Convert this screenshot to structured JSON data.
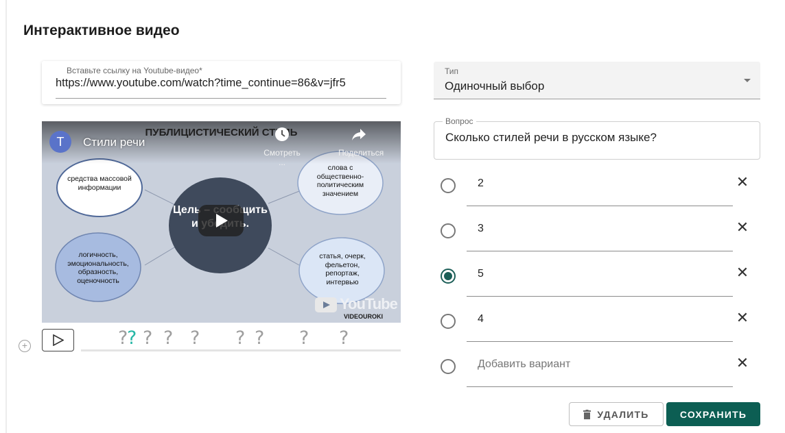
{
  "page": {
    "title": "Интерактивное видео"
  },
  "url_field": {
    "label": "Вставьте ссылку на Youtube-видео*",
    "value": "https://www.youtube.com/watch?time_continue=86&v=jfr5"
  },
  "video": {
    "slide_title": "ПУБЛИЦИСТИЧЕСКИЙ СТИЛЬ",
    "channel_initial": "Т",
    "channel_name": "Стили речи",
    "watch_later_label": "Смотреть ...",
    "share_label": "Поделиться",
    "bubbles": [
      "средства массовой информации",
      "слова с общественно-политическим значением",
      "логичность, эмоциональность, образность, оценочность",
      "статья, очерк, фельетон, репортаж, интервью"
    ],
    "center_text": "Цель – сообщить и убедить.",
    "youtube_logo_text": "YouTube",
    "watermark": "VIDEOUROKI"
  },
  "timeline": {
    "markers": [
      "?",
      "?",
      "?",
      "?",
      "?",
      "?",
      "?",
      "?",
      "?"
    ],
    "active_marker_index": 1
  },
  "question_type": {
    "label": "Тип",
    "value": "Одиночный выбор"
  },
  "question": {
    "label": "Вопрос",
    "value": "Сколько стилей речи в русском языке?"
  },
  "options": [
    {
      "text": "2",
      "checked": false
    },
    {
      "text": "3",
      "checked": false
    },
    {
      "text": "5",
      "checked": true
    },
    {
      "text": "4",
      "checked": false
    }
  ],
  "add_option": {
    "placeholder": "Добавить вариант"
  },
  "buttons": {
    "delete_label": "УДАЛИТЬ",
    "save_label": "СОХРАНИТЬ"
  },
  "colors": {
    "accent": "#0c5e53",
    "active_marker": "#26b7a6"
  },
  "icons": {
    "remove": "close-icon",
    "delete": "trash-icon",
    "add_marker": "plus-circle-icon",
    "play": "play-icon",
    "dropdown": "caret-down-icon"
  }
}
